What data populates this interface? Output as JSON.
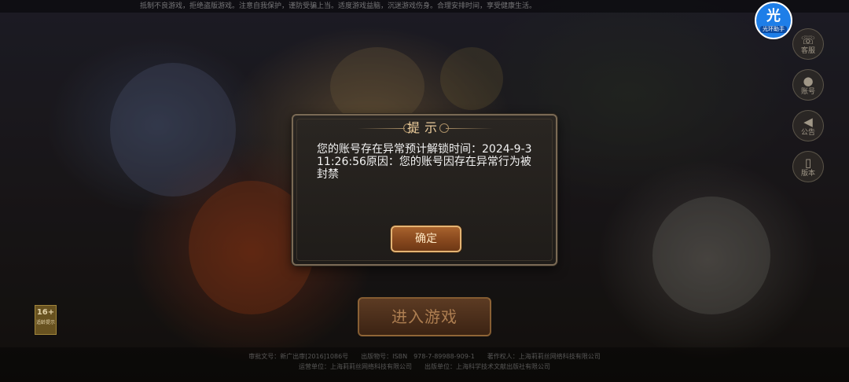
{
  "top_notice": "抵制不良游戏，拒绝盗版游戏。注意自我保护，谨防受骗上当。适度游戏益脑，沉迷游戏伤身。合理安排时间，享受健康生活。",
  "helper": {
    "glyph": "光",
    "label": "光环助手"
  },
  "side_buttons": [
    {
      "label": "客服",
      "icon": "headset-icon"
    },
    {
      "label": "账号",
      "icon": "user-icon"
    },
    {
      "label": "公告",
      "icon": "speaker-icon"
    },
    {
      "label": "版本",
      "icon": "phone-icon"
    }
  ],
  "age_badge": {
    "rating": "16+",
    "note": "适龄提示"
  },
  "enter_game": {
    "label": "进入游戏"
  },
  "footer": {
    "line1": "审批文号：新广出审[2016]1086号　　出版物号：ISBN　978-7-89988-909-1　　著作权人：上海莉莉丝网络科技有限公司",
    "line2": "运营单位：上海莉莉丝网络科技有限公司　　出版单位：上海科学技术文献出版社有限公司"
  },
  "dialog": {
    "title": "提示",
    "message": "您的账号存在异常预计解锁时间：2024-9-3\n11:26:56原因：您的账号因存在异常行为被封禁",
    "confirm_label": "确定"
  }
}
